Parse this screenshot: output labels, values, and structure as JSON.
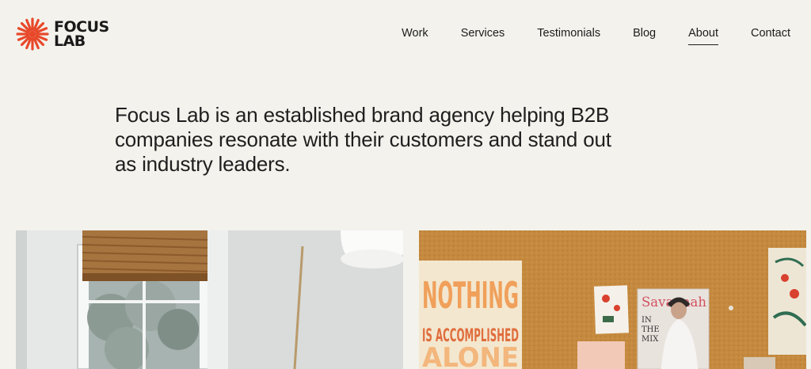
{
  "brand": {
    "line1": "FOCUS",
    "line2": "LAB",
    "accent_color": "#e8492a"
  },
  "nav": {
    "items": [
      {
        "label": "Work",
        "active": false
      },
      {
        "label": "Services",
        "active": false
      },
      {
        "label": "Testimonials",
        "active": false
      },
      {
        "label": "Blog",
        "active": false
      },
      {
        "label": "About",
        "active": true
      },
      {
        "label": "Contact",
        "active": false
      }
    ]
  },
  "intro": {
    "text": "Focus Lab is an established brand agency helping B2B companies resonate with their customers and stand out as industry leaders."
  },
  "gallery": {
    "poster": {
      "line1": "NOTHING",
      "line2": "IS ACCOMPLISHED",
      "line3": "ALONE"
    },
    "magazine": {
      "title": "Savannah",
      "line1": "IN",
      "line2": "THE",
      "line3": "MIX"
    }
  }
}
